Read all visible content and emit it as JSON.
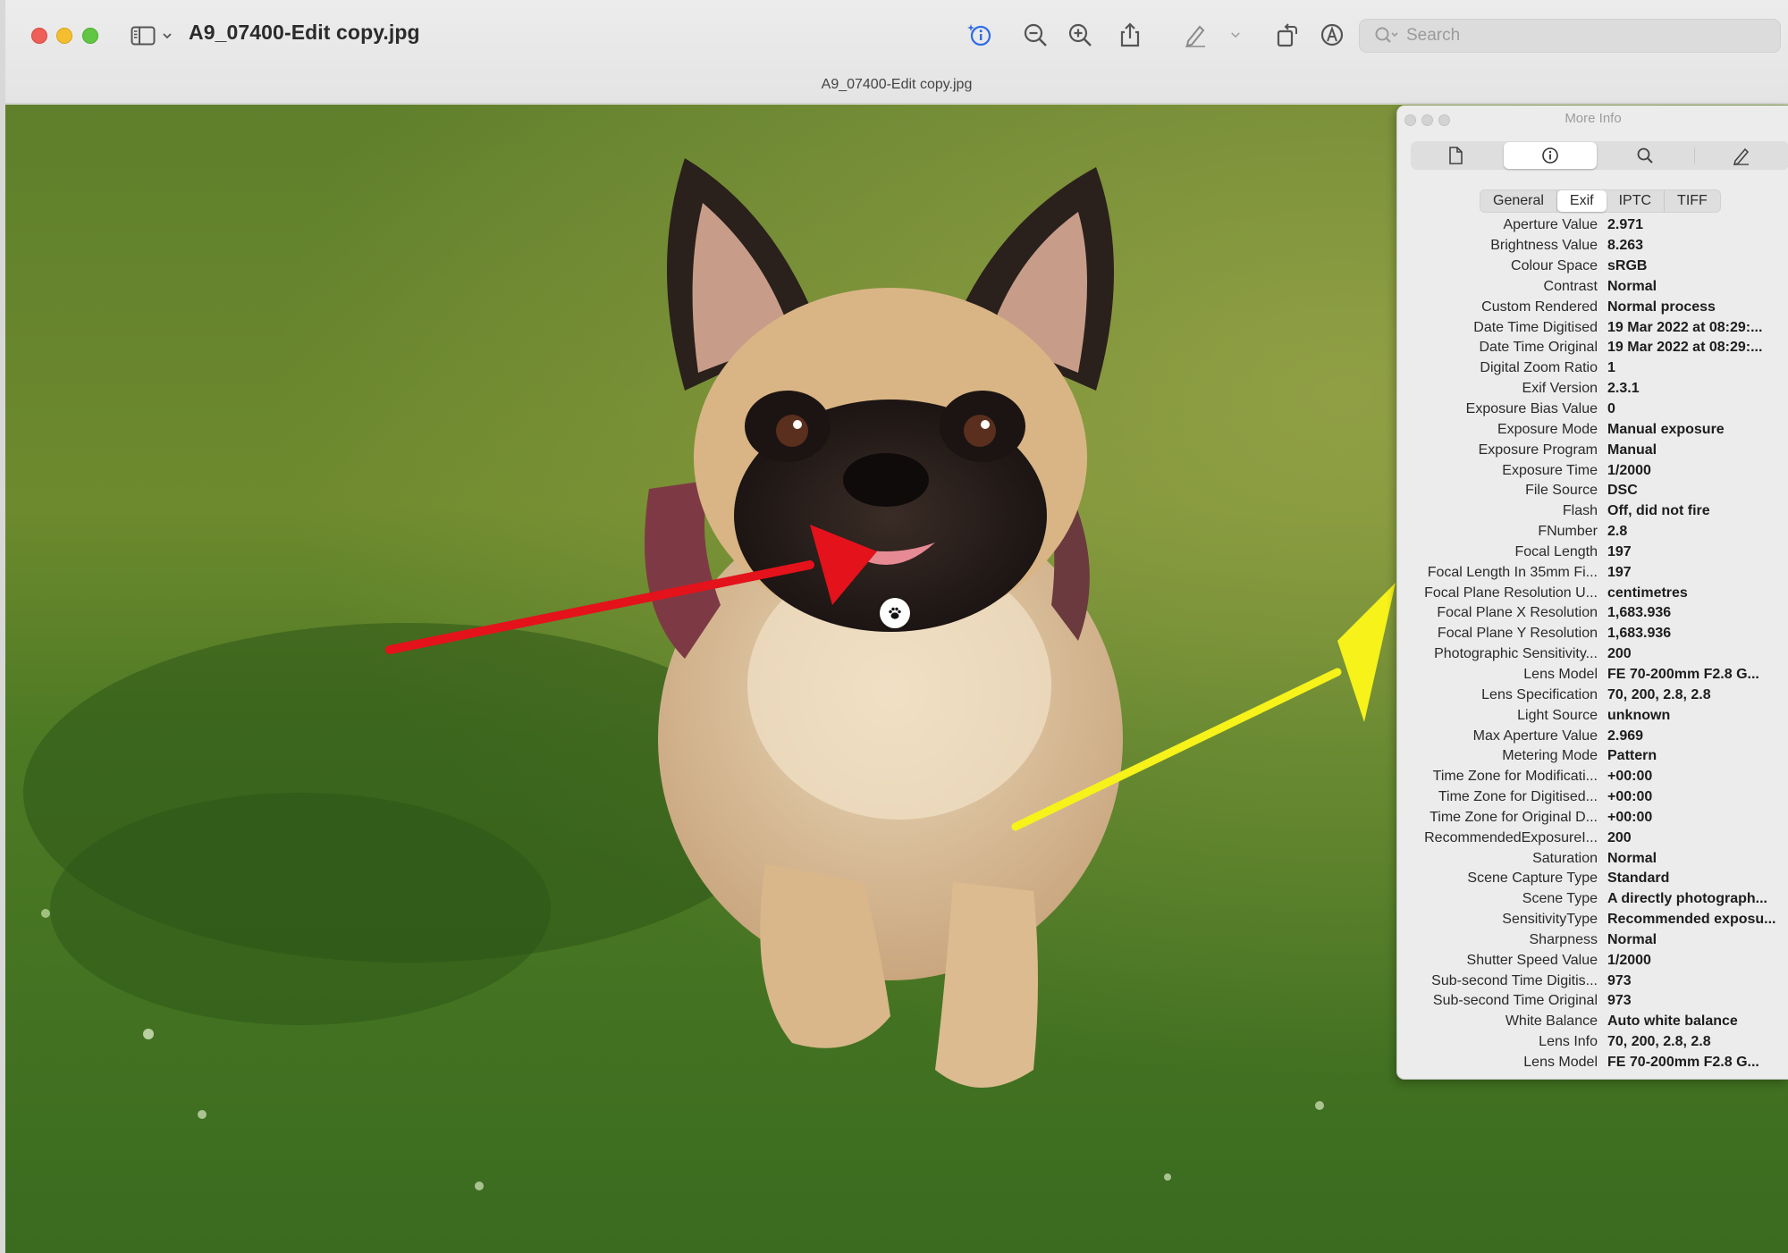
{
  "window": {
    "title": "A9_07400-Edit copy.jpg",
    "subtitle": "A9_07400-Edit copy.jpg"
  },
  "toolbar": {
    "icons": [
      "sidebar-icon",
      "chevron-down-icon",
      "info-sparkle-icon",
      "zoom-out-icon",
      "zoom-in-icon",
      "share-icon",
      "markup-pen-icon",
      "chevron-down-icon",
      "rotate-icon",
      "annotate-icon"
    ],
    "search_placeholder": "Search",
    "accent_color": "#2e6be6"
  },
  "photo": {
    "annotations": [
      "red-arrow",
      "yellow-arrow",
      "paw-badge"
    ],
    "arrow_colors": {
      "red": "#e3121b",
      "yellow": "#f6f21a"
    }
  },
  "info_panel": {
    "title": "More Info",
    "tabs": [
      "document-icon",
      "info-icon",
      "search-icon",
      "pencil-icon"
    ],
    "active_tab": "info-icon",
    "segments": [
      "General",
      "Exif",
      "IPTC",
      "TIFF"
    ],
    "active_segment": "Exif",
    "rows": [
      {
        "key": "Aperture Value",
        "value": "2.971"
      },
      {
        "key": "Brightness Value",
        "value": "8.263"
      },
      {
        "key": "Colour Space",
        "value": "sRGB"
      },
      {
        "key": "Contrast",
        "value": "Normal"
      },
      {
        "key": "Custom Rendered",
        "value": "Normal process"
      },
      {
        "key": "Date Time Digitised",
        "value": "19 Mar 2022 at 08:29:..."
      },
      {
        "key": "Date Time Original",
        "value": "19 Mar 2022 at 08:29:..."
      },
      {
        "key": "Digital Zoom Ratio",
        "value": "1"
      },
      {
        "key": "Exif Version",
        "value": "2.3.1"
      },
      {
        "key": "Exposure Bias Value",
        "value": "0"
      },
      {
        "key": "Exposure Mode",
        "value": "Manual exposure"
      },
      {
        "key": "Exposure Program",
        "value": "Manual"
      },
      {
        "key": "Exposure Time",
        "value": "1/2000"
      },
      {
        "key": "File Source",
        "value": "DSC"
      },
      {
        "key": "Flash",
        "value": "Off, did not fire"
      },
      {
        "key": "FNumber",
        "value": "2.8"
      },
      {
        "key": "Focal Length",
        "value": "197"
      },
      {
        "key": "Focal Length In 35mm Fi...",
        "value": "197"
      },
      {
        "key": "Focal Plane Resolution U...",
        "value": "centimetres"
      },
      {
        "key": "Focal Plane X Resolution",
        "value": "1,683.936"
      },
      {
        "key": "Focal Plane Y Resolution",
        "value": "1,683.936"
      },
      {
        "key": "Photographic Sensitivity...",
        "value": "200"
      },
      {
        "key": "Lens Model",
        "value": "FE 70-200mm F2.8 G..."
      },
      {
        "key": "Lens Specification",
        "value": "70, 200, 2.8, 2.8"
      },
      {
        "key": "Light Source",
        "value": "unknown"
      },
      {
        "key": "Max Aperture Value",
        "value": "2.969"
      },
      {
        "key": "Metering Mode",
        "value": "Pattern"
      },
      {
        "key": "Time Zone for Modificati...",
        "value": "+00:00"
      },
      {
        "key": "Time Zone for Digitised...",
        "value": "+00:00"
      },
      {
        "key": "Time Zone for Original D...",
        "value": "+00:00"
      },
      {
        "key": "RecommendedExposureI...",
        "value": "200"
      },
      {
        "key": "Saturation",
        "value": "Normal"
      },
      {
        "key": "Scene Capture Type",
        "value": "Standard"
      },
      {
        "key": "Scene Type",
        "value": "A directly photograph..."
      },
      {
        "key": "SensitivityType",
        "value": "Recommended exposu..."
      },
      {
        "key": "Sharpness",
        "value": "Normal"
      },
      {
        "key": "Shutter Speed Value",
        "value": "1/2000"
      },
      {
        "key": "Sub-second Time Digitis...",
        "value": "973"
      },
      {
        "key": "Sub-second Time Original",
        "value": "973"
      },
      {
        "key": "White Balance",
        "value": "Auto white balance"
      },
      {
        "key": "Lens Info",
        "value": "70, 200, 2.8, 2.8"
      },
      {
        "key": "Lens Model",
        "value": "FE 70-200mm F2.8 G..."
      }
    ]
  }
}
